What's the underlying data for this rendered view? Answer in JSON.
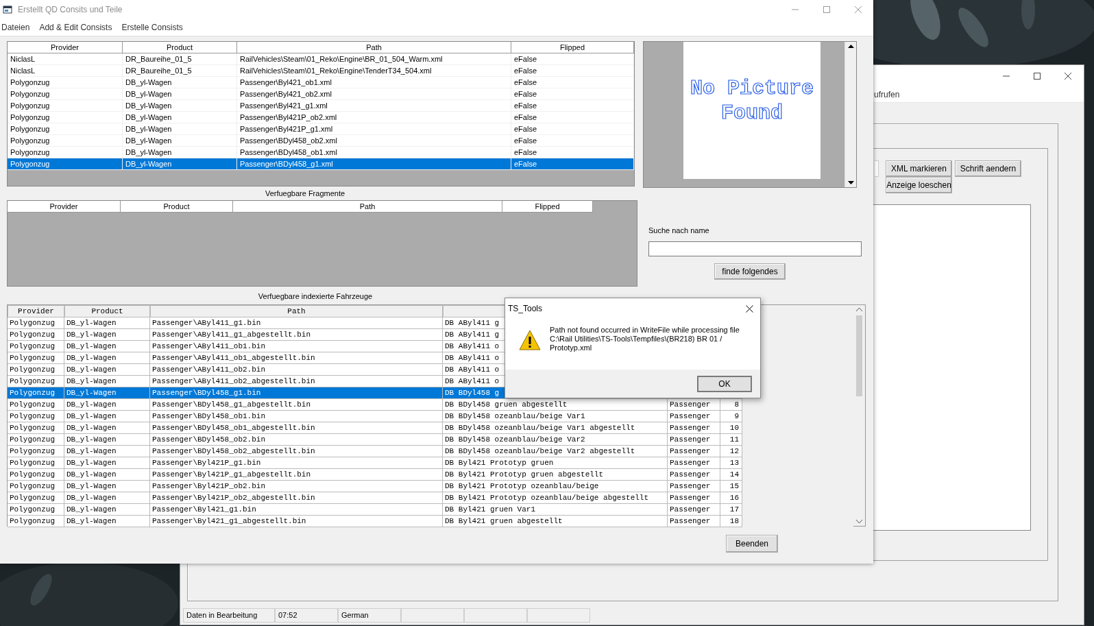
{
  "main_window": {
    "title": "Erstellt QD Consits und Teile",
    "menu": [
      "Dateien",
      "Add & Edit Consists",
      "Erstelle Consists"
    ],
    "consist_table": {
      "columns": [
        "Provider",
        "Product",
        "Path",
        "Flipped"
      ],
      "rows": [
        {
          "cells": [
            "NiclasL",
            "DR_Baureihe_01_5",
            "RailVehicles\\Steam\\01_Reko\\Engine\\BR_01_504_Warm.xml",
            "eFalse"
          ],
          "selected": false
        },
        {
          "cells": [
            "NiclasL",
            "DR_Baureihe_01_5",
            "RailVehicles\\Steam\\01_Reko\\Engine\\TenderT34_504.xml",
            "eFalse"
          ],
          "selected": false
        },
        {
          "cells": [
            "Polygonzug",
            "DB_yl-Wagen",
            "Passenger\\Byl421_ob1.xml",
            "eFalse"
          ],
          "selected": false
        },
        {
          "cells": [
            "Polygonzug",
            "DB_yl-Wagen",
            "Passenger\\Byl421_ob2.xml",
            "eFalse"
          ],
          "selected": false
        },
        {
          "cells": [
            "Polygonzug",
            "DB_yl-Wagen",
            "Passenger\\Byl421_g1.xml",
            "eFalse"
          ],
          "selected": false
        },
        {
          "cells": [
            "Polygonzug",
            "DB_yl-Wagen",
            "Passenger\\Byl421P_ob2.xml",
            "eFalse"
          ],
          "selected": false
        },
        {
          "cells": [
            "Polygonzug",
            "DB_yl-Wagen",
            "Passenger\\Byl421P_g1.xml",
            "eFalse"
          ],
          "selected": false
        },
        {
          "cells": [
            "Polygonzug",
            "DB_yl-Wagen",
            "Passenger\\BDyl458_ob2.xml",
            "eFalse"
          ],
          "selected": false
        },
        {
          "cells": [
            "Polygonzug",
            "DB_yl-Wagen",
            "Passenger\\BDyl458_ob1.xml",
            "eFalse"
          ],
          "selected": false
        },
        {
          "cells": [
            "Polygonzug",
            "DB_yl-Wagen",
            "Passenger\\BDyl458_g1.xml",
            "eFalse"
          ],
          "selected": true
        }
      ]
    },
    "preview": {
      "text": "No Picture Found"
    },
    "fragments": {
      "title": "Verfuegbare Fragmente",
      "columns": [
        "Provider",
        "Product",
        "Path",
        "Flipped"
      ]
    },
    "search": {
      "label": "Suche nach name",
      "button": "finde folgendes"
    },
    "vehicles": {
      "title": "Verfuegbare indexierte Fahrzeuge",
      "columns": [
        "Provider",
        "Product",
        "Path"
      ],
      "rows": [
        {
          "cells": [
            "Polygonzug",
            "DB_yl-Wagen",
            "Passenger\\AByl411_g1.bin",
            "DB AByl411 g"
          ],
          "selected": false
        },
        {
          "cells": [
            "Polygonzug",
            "DB_yl-Wagen",
            "Passenger\\AByl411_g1_abgestellt.bin",
            "DB AByl411 g"
          ],
          "selected": false
        },
        {
          "cells": [
            "Polygonzug",
            "DB_yl-Wagen",
            "Passenger\\AByl411_ob1.bin",
            "DB AByl411 o"
          ],
          "selected": false
        },
        {
          "cells": [
            "Polygonzug",
            "DB_yl-Wagen",
            "Passenger\\AByl411_ob1_abgestellt.bin",
            "DB AByl411 o"
          ],
          "selected": false
        },
        {
          "cells": [
            "Polygonzug",
            "DB_yl-Wagen",
            "Passenger\\AByl411_ob2.bin",
            "DB AByl411 o"
          ],
          "selected": false
        },
        {
          "cells": [
            "Polygonzug",
            "DB_yl-Wagen",
            "Passenger\\AByl411_ob2_abgestellt.bin",
            "DB AByl411 o"
          ],
          "selected": false
        },
        {
          "cells": [
            "Polygonzug",
            "DB_yl-Wagen",
            "Passenger\\BDyl458_g1.bin",
            "DB BDyl458 g"
          ],
          "selected": true
        },
        {
          "cells": [
            "Polygonzug",
            "DB_yl-Wagen",
            "Passenger\\BDyl458_g1_abgestellt.bin",
            "DB BDyl458 gruen abgestellt",
            "Passenger",
            "8"
          ],
          "selected": false
        },
        {
          "cells": [
            "Polygonzug",
            "DB_yl-Wagen",
            "Passenger\\BDyl458_ob1.bin",
            "DB BDyl458 ozeanblau/beige Var1",
            "Passenger",
            "9"
          ],
          "selected": false
        },
        {
          "cells": [
            "Polygonzug",
            "DB_yl-Wagen",
            "Passenger\\BDyl458_ob1_abgestellt.bin",
            "DB BDyl458 ozeanblau/beige Var1 abgestellt",
            "Passenger",
            "10"
          ],
          "selected": false
        },
        {
          "cells": [
            "Polygonzug",
            "DB_yl-Wagen",
            "Passenger\\BDyl458_ob2.bin",
            "DB BDyl458 ozeanblau/beige Var2",
            "Passenger",
            "11"
          ],
          "selected": false
        },
        {
          "cells": [
            "Polygonzug",
            "DB_yl-Wagen",
            "Passenger\\BDyl458_ob2_abgestellt.bin",
            "DB BDyl458 ozeanblau/beige Var2 abgestellt",
            "Passenger",
            "12"
          ],
          "selected": false
        },
        {
          "cells": [
            "Polygonzug",
            "DB_yl-Wagen",
            "Passenger\\Byl421P_g1.bin",
            "DB Byl421 Prototyp gruen",
            "Passenger",
            "13"
          ],
          "selected": false
        },
        {
          "cells": [
            "Polygonzug",
            "DB_yl-Wagen",
            "Passenger\\Byl421P_g1_abgestellt.bin",
            "DB Byl421 Prototyp gruen abgestellt",
            "Passenger",
            "14"
          ],
          "selected": false
        },
        {
          "cells": [
            "Polygonzug",
            "DB_yl-Wagen",
            "Passenger\\Byl421P_ob2.bin",
            "DB Byl421 Prototyp ozeanblau/beige",
            "Passenger",
            "15"
          ],
          "selected": false
        },
        {
          "cells": [
            "Polygonzug",
            "DB_yl-Wagen",
            "Passenger\\Byl421P_ob2_abgestellt.bin",
            "DB Byl421 Prototyp ozeanblau/beige abgestellt",
            "Passenger",
            "16"
          ],
          "selected": false
        },
        {
          "cells": [
            "Polygonzug",
            "DB_yl-Wagen",
            "Passenger\\Byl421_g1.bin",
            "DB Byl421 gruen Var1",
            "Passenger",
            "17"
          ],
          "selected": false
        },
        {
          "cells": [
            "Polygonzug",
            "DB_yl-Wagen",
            "Passenger\\Byl421_g1_abgestellt.bin",
            "DB Byl421 gruen abgestellt",
            "Passenger",
            "18"
          ],
          "selected": false
        }
      ]
    },
    "close_button": "Beenden"
  },
  "dialog": {
    "title": "TS_Tools",
    "message": "Path not found occurred in WriteFile while processing file C:\\Rail Utilities\\TS-Tools\\Tempfiles\\(BR218) BR 01 / Prototyp.xml",
    "button": "OK"
  },
  "back_window": {
    "menu_fragment": "ufrufen",
    "buttons": [
      "XML markieren",
      "Schrift aendern",
      "Anzeige loeschen"
    ],
    "status_bar": [
      "Daten in Bearbeitung",
      "07:52",
      "German"
    ]
  }
}
